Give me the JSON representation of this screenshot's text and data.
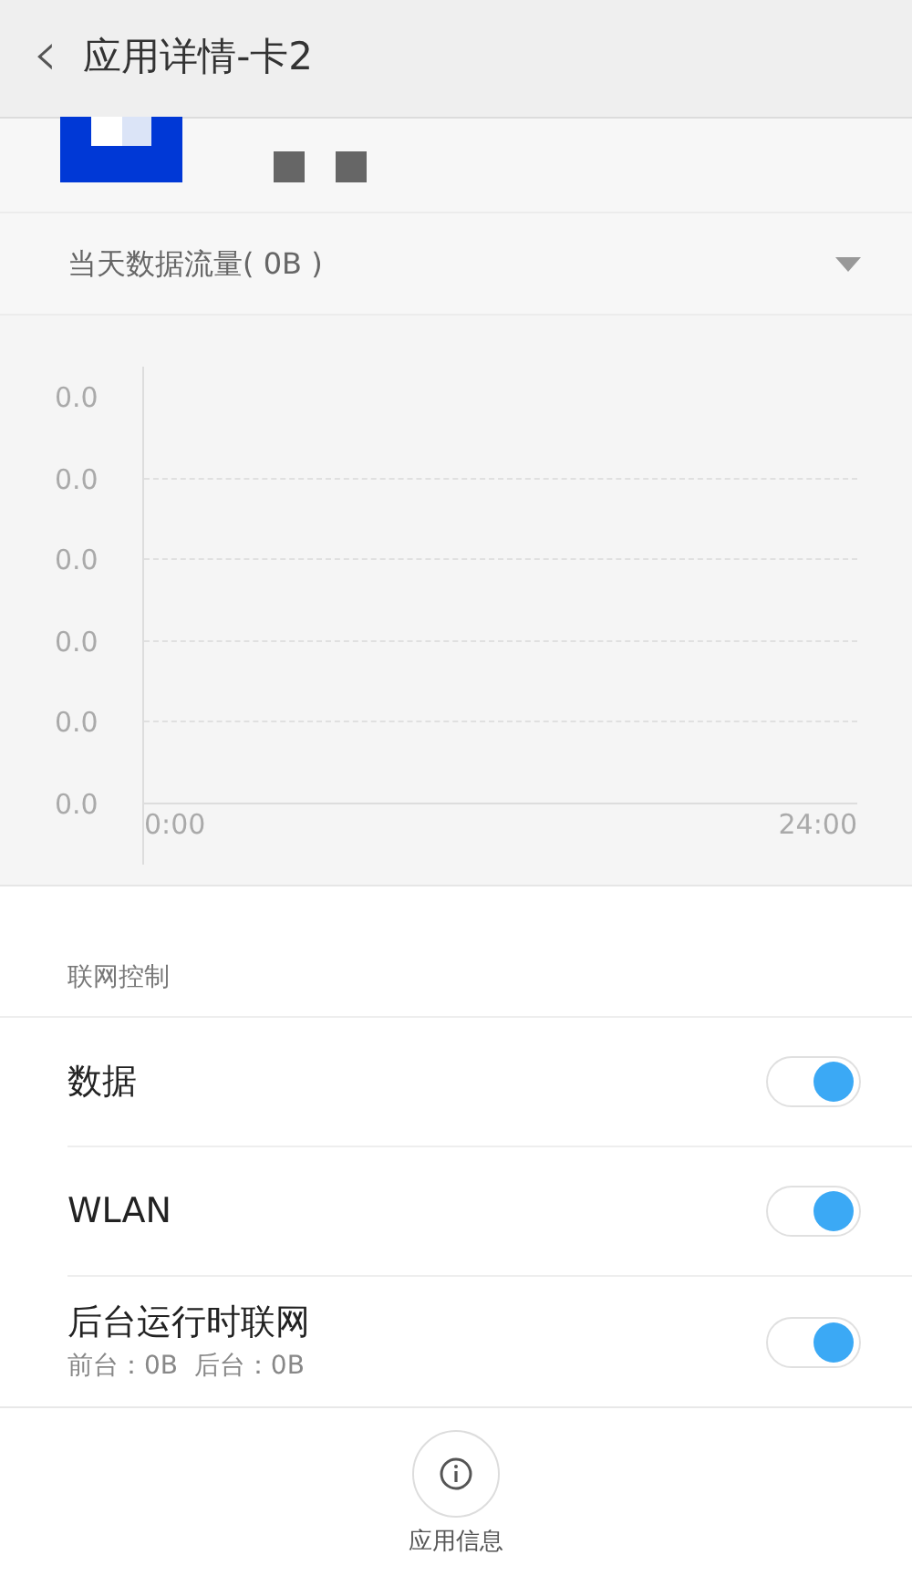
{
  "header": {
    "back_icon": "‹",
    "title": "应用详情-卡2"
  },
  "usage_selector": {
    "label": "当天数据流量( 0B )"
  },
  "chart": {
    "y_labels": [
      "0.0",
      "0.0",
      "0.0",
      "0.0",
      "0.0",
      "0.0"
    ],
    "x_labels": [
      "0:00",
      "24:00"
    ]
  },
  "section_title": "联网控制",
  "settings": [
    {
      "label": "数据",
      "on": true
    },
    {
      "label": "WLAN",
      "on": true
    },
    {
      "label": "后台运行时联网",
      "subtitle": "前台：0B  后台：0B",
      "on": true
    }
  ],
  "bottom_action": {
    "label": "应用信息"
  }
}
